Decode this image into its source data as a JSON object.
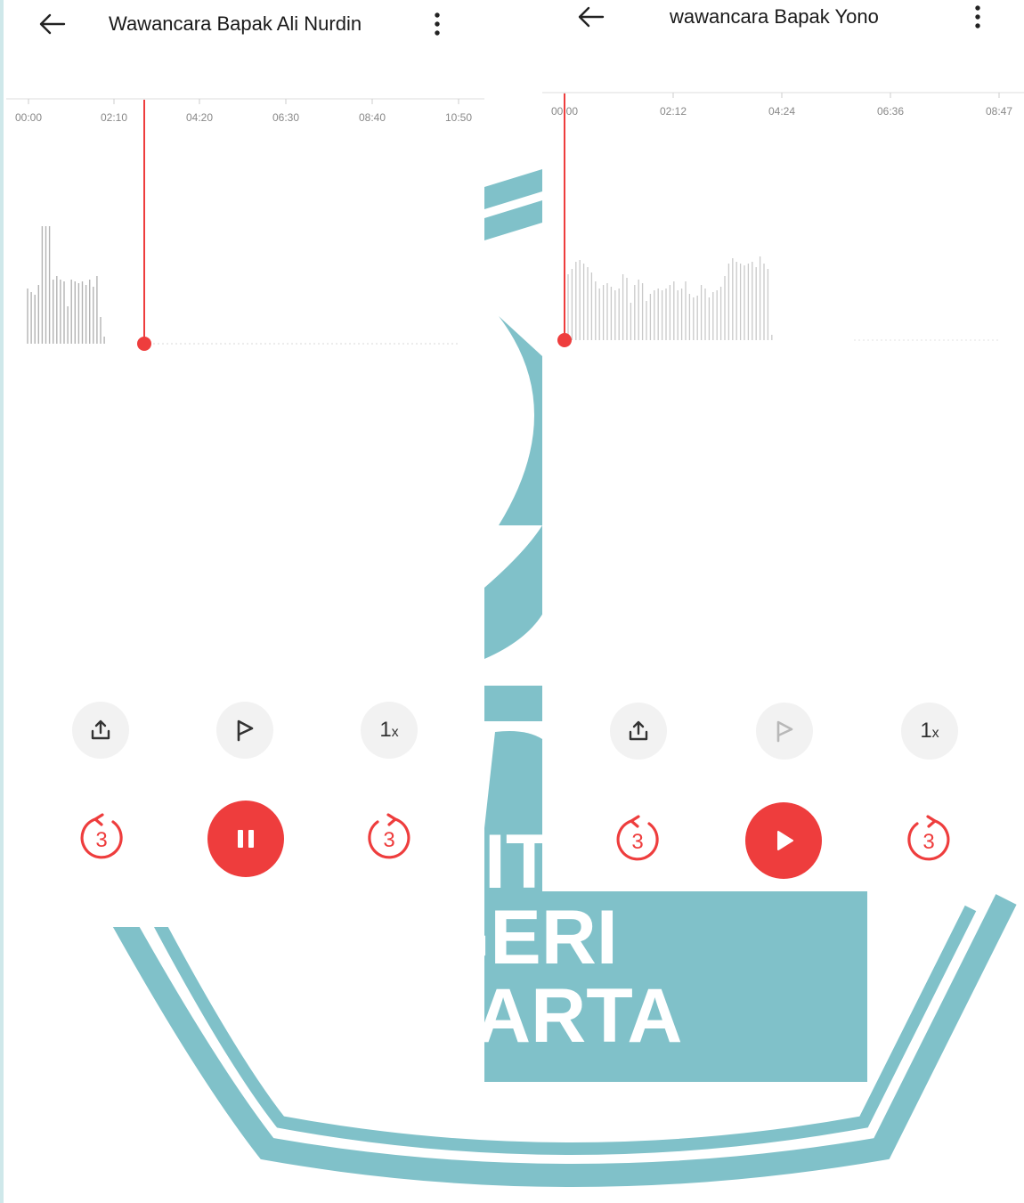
{
  "colors": {
    "accent": "#ee3d3d",
    "watermark": "#80c1c9",
    "waveform": "#b3b3b3"
  },
  "watermark_lines": [
    "NEGERI",
    "JAKARTA"
  ],
  "watermark_fragment": "IT",
  "left_player": {
    "title": "Wawancara Bapak Ali Nurdin",
    "timeline_labels": [
      "00:00",
      "02:10",
      "04:20",
      "06:30",
      "08:40",
      "10:50"
    ],
    "playhead_time_fraction": 0.25,
    "state": "playing",
    "speed": {
      "value": "1",
      "unit": "x"
    },
    "skip_seconds": "3",
    "icons": [
      "arrow-left-icon",
      "more-vertical-icon",
      "share-icon",
      "flag-icon",
      "replay-3-icon",
      "pause-icon",
      "forward-3-icon"
    ]
  },
  "right_player": {
    "title": "wawancara Bapak Yono",
    "timeline_labels": [
      "00:00",
      "02:12",
      "04:24",
      "06:36",
      "08:47"
    ],
    "playhead_time_fraction": 0.0,
    "state": "paused",
    "speed": {
      "value": "1",
      "unit": "x"
    },
    "skip_seconds": "3",
    "icons": [
      "arrow-left-icon",
      "more-vertical-icon",
      "share-icon",
      "flag-icon",
      "replay-3-icon",
      "play-icon",
      "forward-3-icon"
    ]
  }
}
